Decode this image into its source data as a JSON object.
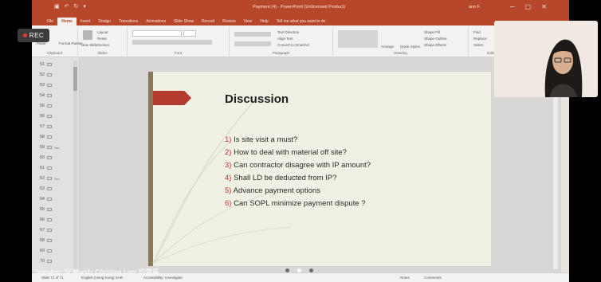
{
  "window": {
    "title": "Payment (4) - PowerPoint (Unlicensed Product)",
    "account": "ann F",
    "controls": [
      "─",
      "▢",
      "✕"
    ]
  },
  "ribbon_tabs": [
    "File",
    "Home",
    "Insert",
    "Design",
    "Transitions",
    "Animations",
    "Slide Show",
    "Record",
    "Review",
    "View",
    "Help",
    "Tell me what you want to do"
  ],
  "ribbon": {
    "clipboard": {
      "label": "Clipboard",
      "paste": "Paste",
      "format_painter": "Format Painter"
    },
    "slides": {
      "label": "Slides",
      "new_slide": "New Slide",
      "layout": "Layout",
      "reset": "Reset",
      "section": "Section"
    },
    "font": {
      "label": "Font"
    },
    "paragraph": {
      "label": "Paragraph",
      "text_direction": "Text Direction",
      "align_text": "Align Text",
      "convert": "Convert to SmartArt"
    },
    "drawing": {
      "label": "Drawing",
      "arrange": "Arrange",
      "quick_styles": "Quick Styles",
      "shape_fill": "Shape Fill",
      "shape_outline": "Shape Outline",
      "shape_effects": "Shape Effects"
    },
    "editing": {
      "label": "Editing",
      "find": "Find",
      "replace": "Replace",
      "select": "Select"
    }
  },
  "rec_badge": {
    "label": "REC"
  },
  "slide_panel": {
    "numbers": [
      "51",
      "52",
      "53",
      "54",
      "55",
      "56",
      "57",
      "58",
      "59",
      "60",
      "61",
      "62",
      "63",
      "64",
      "65",
      "66",
      "67",
      "68",
      "69",
      "70"
    ],
    "labels": [
      "",
      "",
      "",
      "",
      "",
      "",
      "",
      "",
      "Sec",
      "",
      "",
      "Sec",
      "",
      "",
      "",
      "",
      "",
      "",
      "",
      ""
    ]
  },
  "slide": {
    "title": "Discussion",
    "items": [
      {
        "num": "1)",
        "text": "Is site visit a must?"
      },
      {
        "num": "2)",
        "text": "How to deal with material off site?"
      },
      {
        "num": "3)",
        "text": "Can contractor disagree with IP amount?"
      },
      {
        "num": "4)",
        "text": "Shall LD be deducted from IP?"
      },
      {
        "num": "5)",
        "text": "Advance payment options"
      },
      {
        "num": "6)",
        "text": "Can SOPL minimize payment dispute ?"
      }
    ]
  },
  "status_bar": {
    "slide_info": "Slide 71 of 71",
    "language": "English (Hong Kong) SAR",
    "accessibility": "Accessibility: Investigate",
    "notes": "Notes",
    "comments": "Comments"
  },
  "caption": {
    "speaker": "Speaker: Sr Mandy Christina Lam 的螢幕"
  },
  "pager": {
    "dots": 3,
    "active": 1
  },
  "colors": {
    "titlebar": "#b7472a",
    "accent": "#b23a2e",
    "slide_bg": "#f1f0e4",
    "rec_dot": "#e03b2e"
  }
}
